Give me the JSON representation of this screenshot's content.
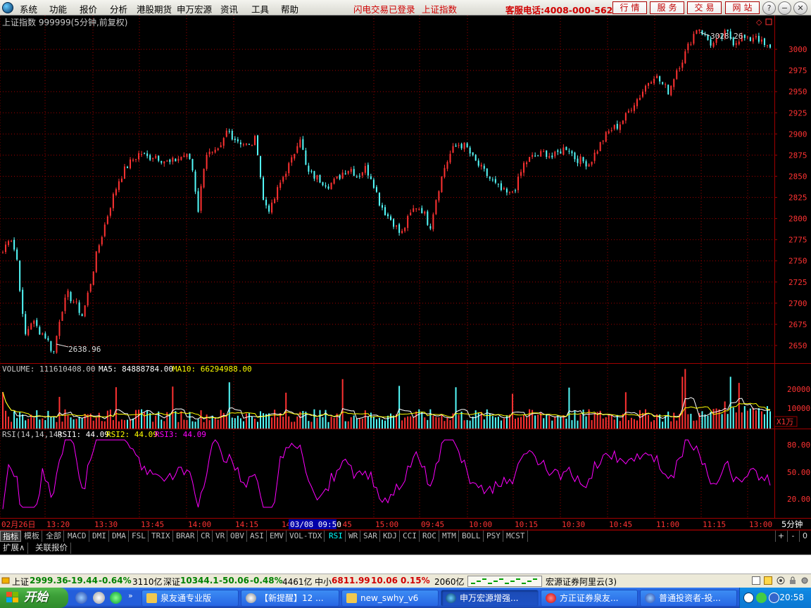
{
  "menubar": {
    "items": [
      "系统",
      "功能",
      "报价",
      "分析",
      "港股期货",
      "申万宏源",
      "资讯",
      "工具",
      "帮助"
    ],
    "red_links": [
      "闪电交易已登录",
      "上证指数"
    ],
    "hotline": "客服电话:4008-000-562",
    "buttons": [
      "行情",
      "服务",
      "交易",
      "网站"
    ],
    "window_buttons": [
      "?",
      "−",
      "❐",
      "✕"
    ]
  },
  "chart": {
    "title": "上证指数 999999(5分钟,前复权)",
    "price_labels": [
      "3000",
      "2975",
      "2950",
      "2925",
      "2900",
      "2875",
      "2850",
      "2825",
      "2800",
      "2775",
      "2750",
      "2725",
      "2700",
      "2675",
      "2650"
    ],
    "high_label": "3028.26",
    "low_label": "2638.96",
    "volume_header": {
      "label": "VOLUME: 111610408.00",
      "ma5": "MA5: 84888784.00",
      "ma10": "MA10: 66294988.00"
    },
    "volume_labels": [
      "20000",
      "10000"
    ],
    "volume_unit": "X1万",
    "rsi_header": {
      "label": "RSI(14,14,14)",
      "rsi1": "RSI1: 44.09",
      "rsi2": "RSI2: 44.09",
      "rsi3": "RSI3: 44.09"
    },
    "rsi_labels": [
      "80.00",
      "50.00",
      "20.00"
    ],
    "time_labels": [
      "02月26日",
      "13:20",
      "13:30",
      "13:45",
      "14:00",
      "14:15",
      "14",
      "03/08 09:50",
      ":45",
      "15:00",
      "09:45",
      "10:00",
      "10:15",
      "10:30",
      "10:45",
      "11:00",
      "11:15",
      "13:00"
    ],
    "period": "5分钟",
    "colors": {
      "up": "#ff3232",
      "down": "#54fcfc",
      "grid": "#a00000",
      "rsi": "#ff00ff",
      "ma5": "#ffffff",
      "ma10": "#ffff00"
    }
  },
  "chart_data": {
    "type": "candlestick",
    "title": "上证指数 999999(5分钟,前复权)",
    "ylim": [
      2630,
      3040
    ],
    "price_path": [
      2760,
      2782,
      2750,
      2660,
      2680,
      2668,
      2660,
      2640,
      2690,
      2710,
      2700,
      2685,
      2720,
      2760,
      2790,
      2820,
      2845,
      2860,
      2870,
      2878,
      2872,
      2875,
      2870,
      2865,
      2870,
      2875,
      2870,
      2810,
      2878,
      2875,
      2880,
      2905,
      2895,
      2890,
      2885,
      2895,
      2820,
      2810,
      2835,
      2855,
      2870,
      2900,
      2855,
      2850,
      2845,
      2840,
      2845,
      2855,
      2860,
      2850,
      2860,
      2848,
      2820,
      2805,
      2795,
      2780,
      2800,
      2815,
      2810,
      2790,
      2830,
      2860,
      2880,
      2888,
      2885,
      2870,
      2860,
      2850,
      2840,
      2832,
      2828,
      2840,
      2865,
      2872,
      2875,
      2878,
      2872,
      2880,
      2885,
      2872,
      2868,
      2865,
      2880,
      2895,
      2905,
      2910,
      2920,
      2935,
      2945,
      2960,
      2970,
      2960,
      2950,
      2975,
      2990,
      3010,
      3028,
      3015,
      3005,
      3012,
      3020,
      3008,
      3015,
      3010,
      3018,
      3005,
      3000
    ],
    "high": 3028.26,
    "low": 2638.96,
    "volume": {
      "last": 111610408.0,
      "ma5": 84888784.0,
      "ma10": 66294988.0,
      "ylim": [
        0,
        25000
      ],
      "unit": "X1万"
    },
    "rsi": {
      "params": [
        14,
        14,
        14
      ],
      "rsi1": 44.09,
      "rsi2": 44.09,
      "rsi3": 44.09,
      "ylim": [
        0,
        100
      ],
      "levels": [
        20,
        50,
        80
      ]
    }
  },
  "tabs": {
    "items": [
      "指标",
      "模板",
      "全部",
      "MACD",
      "DMI",
      "DMA",
      "FSL",
      "TRIX",
      "BRAR",
      "CR",
      "VR",
      "OBV",
      "ASI",
      "EMV",
      "VOL-TDX",
      "RSI",
      "WR",
      "SAR",
      "KDJ",
      "CCI",
      "ROC",
      "MTM",
      "BOLL",
      "PSY",
      "MCST"
    ],
    "active": "RSI",
    "controls": [
      "+",
      "-",
      "0"
    ]
  },
  "extrow": {
    "items": [
      "扩展∧",
      "关联报价"
    ]
  },
  "status": {
    "sh_label": "上证",
    "sh_price": "2999.36",
    "sh_change": "-19.44",
    "sh_pct": "-0.64%",
    "sh_amount": "3110亿",
    "sz_label": "深证",
    "sz_price": "10344.1",
    "sz_change": "-50.06",
    "sz_pct": "-0.48%",
    "sz_amount": "4461亿",
    "zx_label": "中小",
    "zx_price": "6811.99",
    "zx_change": "10.06",
    "zx_pct": "0.15%",
    "zx_amount": "2060亿",
    "server": "宏源证券阿里云(3)"
  },
  "taskbar": {
    "start": "开始",
    "tasks": [
      "泉友通专业版",
      "【新提醒】12 ...",
      "new_swhy_v6",
      "申万宏源增强...",
      "方正证券泉友...",
      "普通投资者-投..."
    ],
    "clock": "20:58"
  }
}
